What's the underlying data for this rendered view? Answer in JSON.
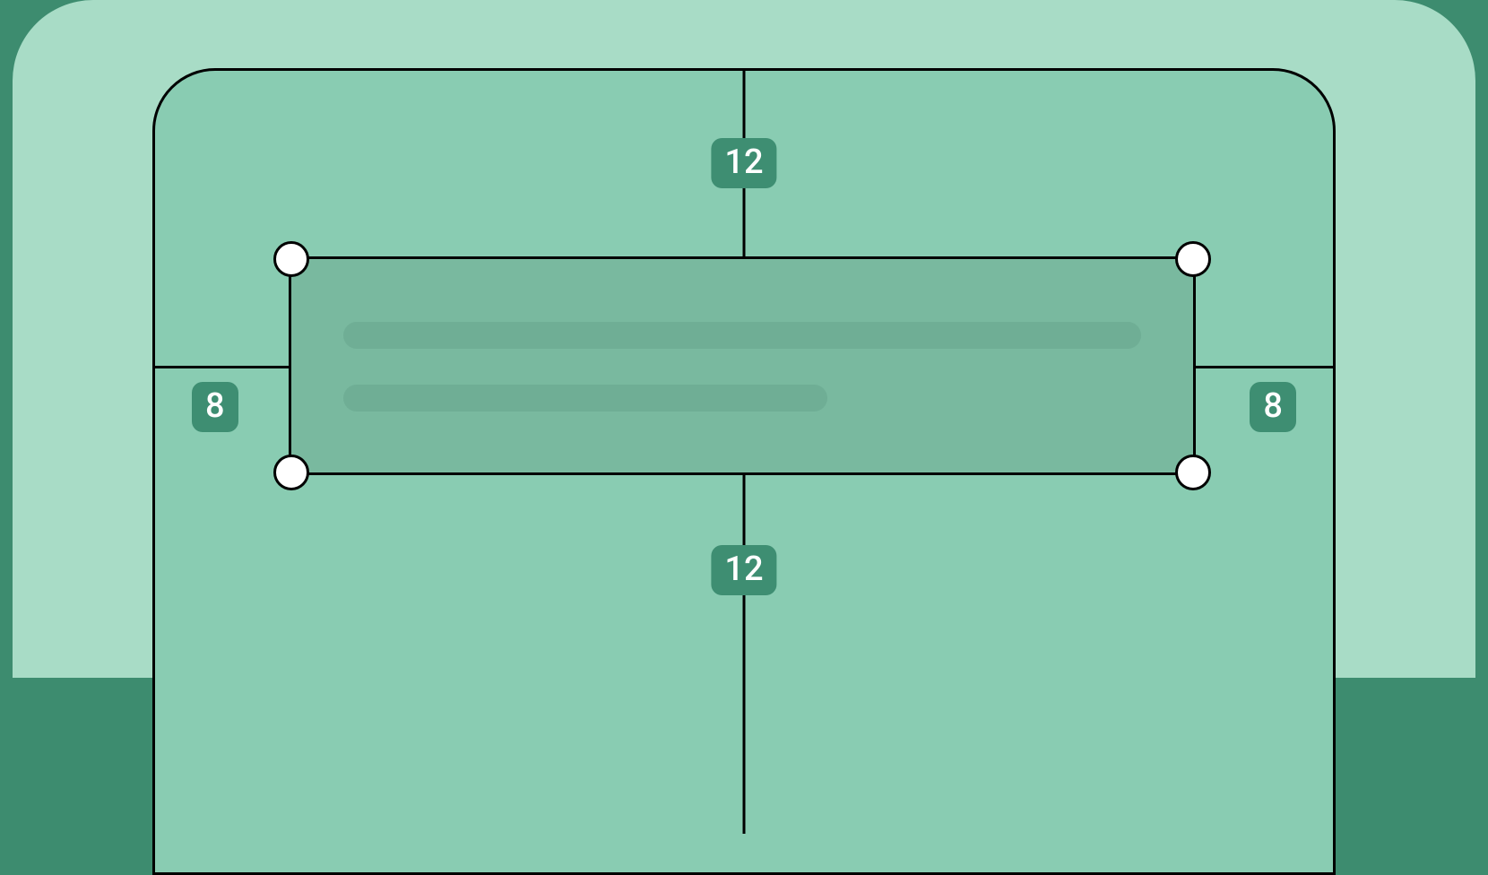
{
  "diagram": {
    "type": "padding-spec",
    "measurements": {
      "top": "12",
      "bottom": "12",
      "left": "8",
      "right": "8"
    },
    "colors": {
      "background": "#3d8c6f",
      "panel": "#a8dcc6",
      "container": "#89ccb2",
      "selected": "#79b99f",
      "content_line": "#6fae95",
      "badge": "#3e8e72",
      "badge_text": "#ffffff",
      "handle": "#ffffff",
      "stroke": "#000000"
    }
  }
}
